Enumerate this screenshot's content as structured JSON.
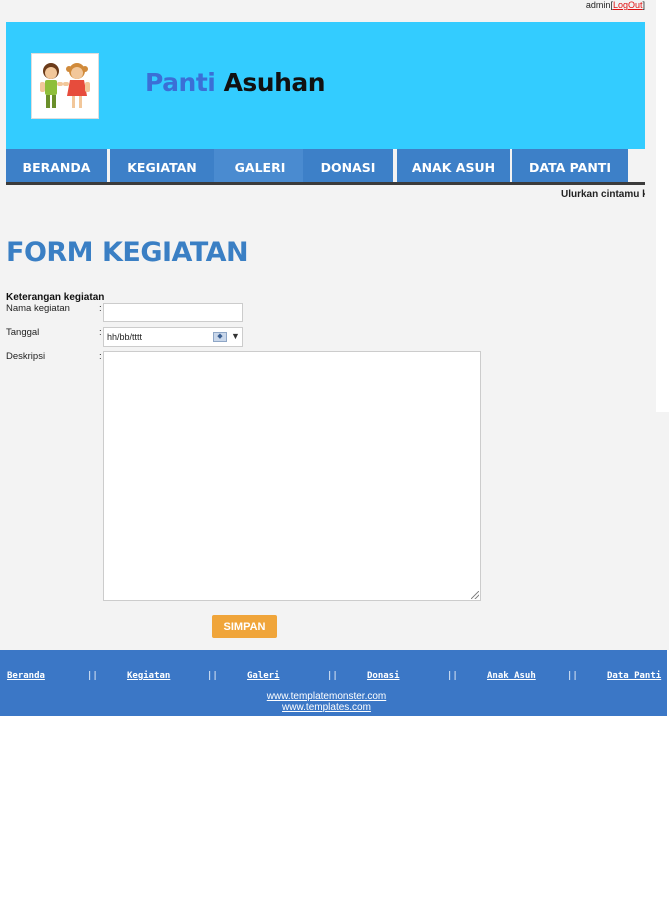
{
  "topbar": {
    "user": "admin",
    "logout": "LogOut",
    "bracket_open": "[",
    "bracket_close": "]"
  },
  "header": {
    "title_part1": "Panti",
    "title_part2": "Asuhan",
    "logo_icon": "children-logo-icon"
  },
  "nav": [
    "BERANDA",
    "KEGIATAN",
    "GALERI",
    "DONASI",
    "ANAK ASUH",
    "DATA PANTI"
  ],
  "marquee": "Ulurkan cintamu k",
  "form": {
    "title": "FORM KEGIATAN",
    "section_label": "Keterangan kegiatan",
    "fields": {
      "name_label": "Nama kegiatan",
      "date_label": "Tanggal",
      "date_placeholder": "hh/bb/tttt",
      "desc_label": "Deskripsi"
    },
    "colon": ":",
    "submit": "SIMPAN"
  },
  "footer": {
    "links": [
      "Beranda",
      "Kegiatan",
      "Galeri",
      "Donasi",
      "Anak Asuh",
      "Data Panti"
    ],
    "separator": "||",
    "urls": [
      "www.templatemonster.com",
      "www.templates.com"
    ]
  },
  "colors": {
    "header": "#33ccff",
    "nav": "#3d80c8",
    "button": "#f0a53a",
    "footer": "#3b77c6",
    "title": "#3a7fc4"
  }
}
